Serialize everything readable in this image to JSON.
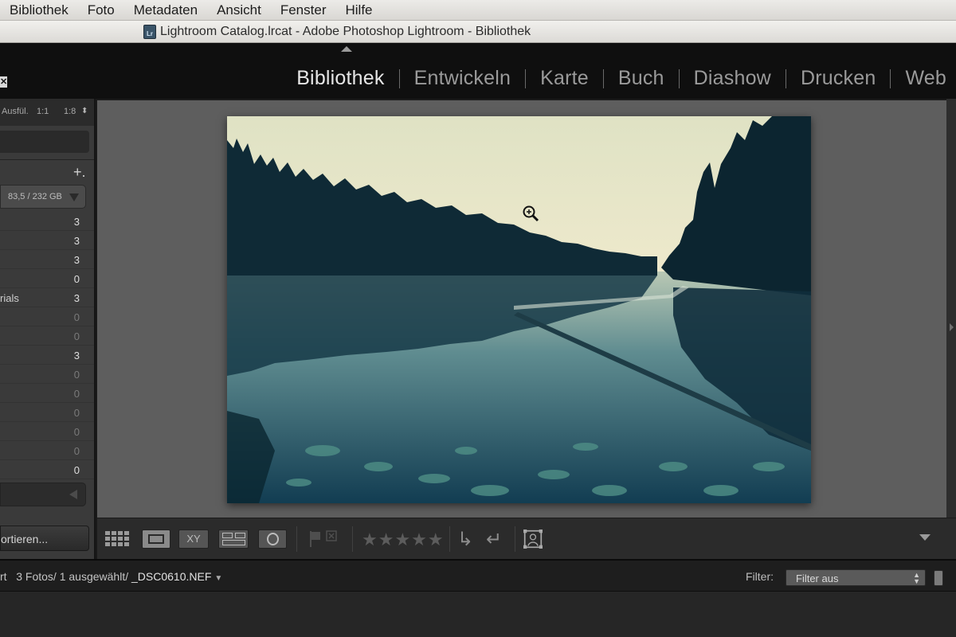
{
  "menubar": {
    "items": [
      "Bibliothek",
      "Foto",
      "Metadaten",
      "Ansicht",
      "Fenster",
      "Hilfe"
    ]
  },
  "window": {
    "title": "Lightroom Catalog.lrcat - Adobe Photoshop Lightroom - Bibliothek",
    "icon_label": "Lr"
  },
  "modules": {
    "items": [
      "Bibliothek",
      "Entwickeln",
      "Karte",
      "Buch",
      "Diashow",
      "Drucken",
      "Web"
    ],
    "active": "Bibliothek"
  },
  "navigator": {
    "zoom_options": [
      "Ausfül.",
      "1:1",
      "1:8"
    ]
  },
  "folders": {
    "add_symbol": "+.",
    "volume_text": "83,5 / 232 GB",
    "rows": [
      {
        "label": "",
        "count": "3"
      },
      {
        "label": "",
        "count": "3"
      },
      {
        "label": "",
        "count": "3"
      },
      {
        "label": "",
        "count": "0"
      },
      {
        "label": "rials",
        "count": "3"
      },
      {
        "label": "",
        "count": "0"
      },
      {
        "label": "",
        "count": "0"
      },
      {
        "label": "",
        "count": "3"
      },
      {
        "label": "",
        "count": "0"
      },
      {
        "label": "",
        "count": "0"
      },
      {
        "label": "",
        "count": "0"
      },
      {
        "label": "",
        "count": "0"
      },
      {
        "label": "",
        "count": "0"
      },
      {
        "label": "",
        "count": "0"
      }
    ]
  },
  "import_button": {
    "label": "ortieren..."
  },
  "toolbar": {
    "compare_label": "XY",
    "stars": "★★★★★"
  },
  "filmstrip": {
    "crumb_prefix": "rt",
    "crumb_count": "3 Fotos/ 1 ausgewählt/",
    "filename": "_DSC0610.NEF",
    "filter_label": "Filter:",
    "filter_value": "Filter aus"
  },
  "colors": {
    "panel_bg": "#3a3a3a",
    "loupe_bg": "#5e5e5e",
    "active_module": "#e6e6e6",
    "inactive_module": "#9a9a9a"
  }
}
